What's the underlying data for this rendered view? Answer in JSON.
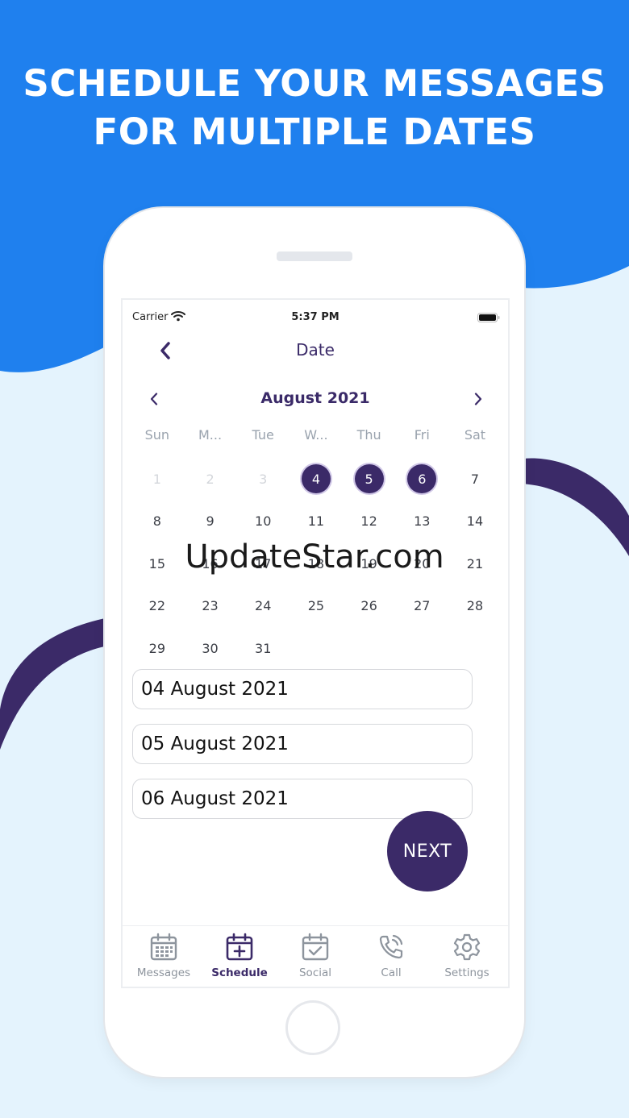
{
  "banner": {
    "line1": "SCHEDULE YOUR MESSAGES",
    "line2": "FOR MULTIPLE DATES"
  },
  "colors": {
    "banner_blue": "#1f80ee",
    "brand_purple": "#3b2a68",
    "background_light": "#e4f3fd"
  },
  "status_bar": {
    "carrier": "Carrier",
    "time": "5:37 PM"
  },
  "nav": {
    "title": "Date",
    "back_icon": "chevron-left-icon"
  },
  "calendar": {
    "month_label": "August 2021",
    "weekdays": [
      "Sun",
      "M...",
      "Tue",
      "W...",
      "Thu",
      "Fri",
      "Sat"
    ],
    "days": [
      {
        "label": "1",
        "state": "muted"
      },
      {
        "label": "2",
        "state": "muted"
      },
      {
        "label": "3",
        "state": "muted"
      },
      {
        "label": "4",
        "state": "selected"
      },
      {
        "label": "5",
        "state": "selected"
      },
      {
        "label": "6",
        "state": "selected"
      },
      {
        "label": "7",
        "state": "normal"
      },
      {
        "label": "8",
        "state": "normal"
      },
      {
        "label": "9",
        "state": "normal"
      },
      {
        "label": "10",
        "state": "normal"
      },
      {
        "label": "11",
        "state": "normal"
      },
      {
        "label": "12",
        "state": "normal"
      },
      {
        "label": "13",
        "state": "normal"
      },
      {
        "label": "14",
        "state": "normal"
      },
      {
        "label": "15",
        "state": "normal"
      },
      {
        "label": "16",
        "state": "normal"
      },
      {
        "label": "17",
        "state": "normal"
      },
      {
        "label": "18",
        "state": "normal"
      },
      {
        "label": "19",
        "state": "normal"
      },
      {
        "label": "20",
        "state": "normal"
      },
      {
        "label": "21",
        "state": "normal"
      },
      {
        "label": "22",
        "state": "normal"
      },
      {
        "label": "23",
        "state": "normal"
      },
      {
        "label": "24",
        "state": "normal"
      },
      {
        "label": "25",
        "state": "normal"
      },
      {
        "label": "26",
        "state": "normal"
      },
      {
        "label": "27",
        "state": "normal"
      },
      {
        "label": "28",
        "state": "normal"
      },
      {
        "label": "29",
        "state": "normal"
      },
      {
        "label": "30",
        "state": "normal"
      },
      {
        "label": "31",
        "state": "normal"
      }
    ]
  },
  "selected_dates": [
    "04 August 2021",
    "05 August 2021",
    "06 August 2021"
  ],
  "next_button": {
    "label": "NEXT"
  },
  "tabs": [
    {
      "label": "Messages",
      "icon": "calendar-grid-icon",
      "active": false
    },
    {
      "label": "Schedule",
      "icon": "calendar-plus-icon",
      "active": true
    },
    {
      "label": "Social",
      "icon": "calendar-check-icon",
      "active": false
    },
    {
      "label": "Call",
      "icon": "phone-call-icon",
      "active": false
    },
    {
      "label": "Settings",
      "icon": "gear-icon",
      "active": false
    }
  ],
  "watermark": "UpdateStar.com"
}
